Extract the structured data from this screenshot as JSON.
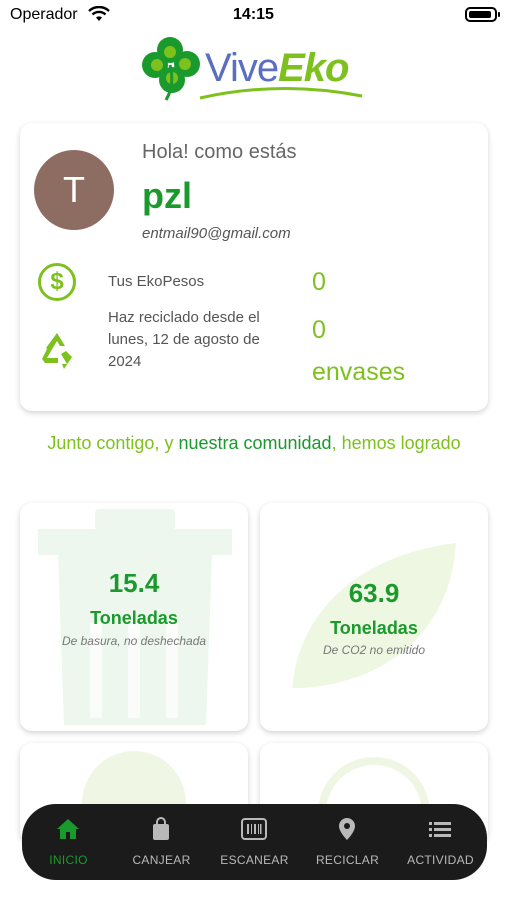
{
  "status_bar": {
    "carrier": "Operador",
    "time": "14:15"
  },
  "logo": {
    "part1": "Vive",
    "part2": "Eko"
  },
  "profile": {
    "avatar_initial": "T",
    "greeting": "Hola! como estás",
    "name": "pzl",
    "email": "entmail90@gmail.com",
    "ekopesos_label": "Tus EkoPesos",
    "ekopesos_value": "0",
    "since_line1": "Haz reciclado desde el",
    "since_line2": "lunes, 12 de agosto de 2024",
    "recycled_value": "0",
    "recycled_unit": "envases"
  },
  "community": {
    "part1": "Junto contigo, y ",
    "part2": "nuestra comunidad",
    "part3": ", hemos logrado"
  },
  "stats": [
    {
      "value": "15.4",
      "unit": "Toneladas",
      "description": "De basura, no deshechada",
      "icon": "trash-icon"
    },
    {
      "value": "63.9",
      "unit": "Toneladas",
      "description": "De CO2 no emitido",
      "icon": "leaf-icon"
    }
  ],
  "nav": {
    "items": [
      {
        "label": "INICIO",
        "icon": "home-icon",
        "active": true
      },
      {
        "label": "CANJEAR",
        "icon": "bag-icon",
        "active": false
      },
      {
        "label": "ESCANEAR",
        "icon": "barcode-icon",
        "active": false
      },
      {
        "label": "RECICLAR",
        "icon": "location-pin-icon",
        "active": false
      },
      {
        "label": "ACTIVIDAD",
        "icon": "list-icon",
        "active": false
      }
    ]
  },
  "colors": {
    "primary_green": "#1a9a2c",
    "accent_green": "#7ec11e",
    "logo_blue": "#5b6fc2",
    "nav_bg": "#1b1b1b"
  }
}
